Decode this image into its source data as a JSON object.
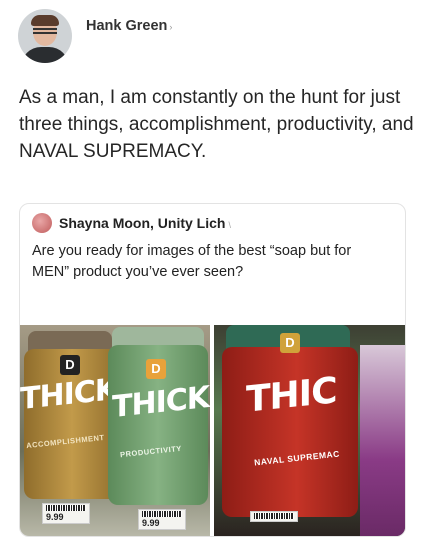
{
  "post": {
    "author": "Hank Green",
    "text": "As a man, I am constantly on the hunt for just three things, accomplishment, productivity, and NAVAL SUPREMACY."
  },
  "quoted": {
    "author": "Shayna Moon, Unity Lich",
    "text": "Are you ready for images of the best “soap but for MEN” product you’ve ever seen?"
  },
  "products": {
    "logo_letter": "D",
    "brand": "THICK",
    "brand_cut": "THIC",
    "jar1_label": "ACCOMPLISHMENT",
    "jar2_label": "PRODUCTIVITY",
    "jar3_label": "NAVAL SUPREMAC",
    "price1": "9.99",
    "price2": "9.99"
  },
  "colors": {
    "jar1": "#b08a3c",
    "jar2": "#6f9a6d",
    "jar3": "#b32a20"
  }
}
